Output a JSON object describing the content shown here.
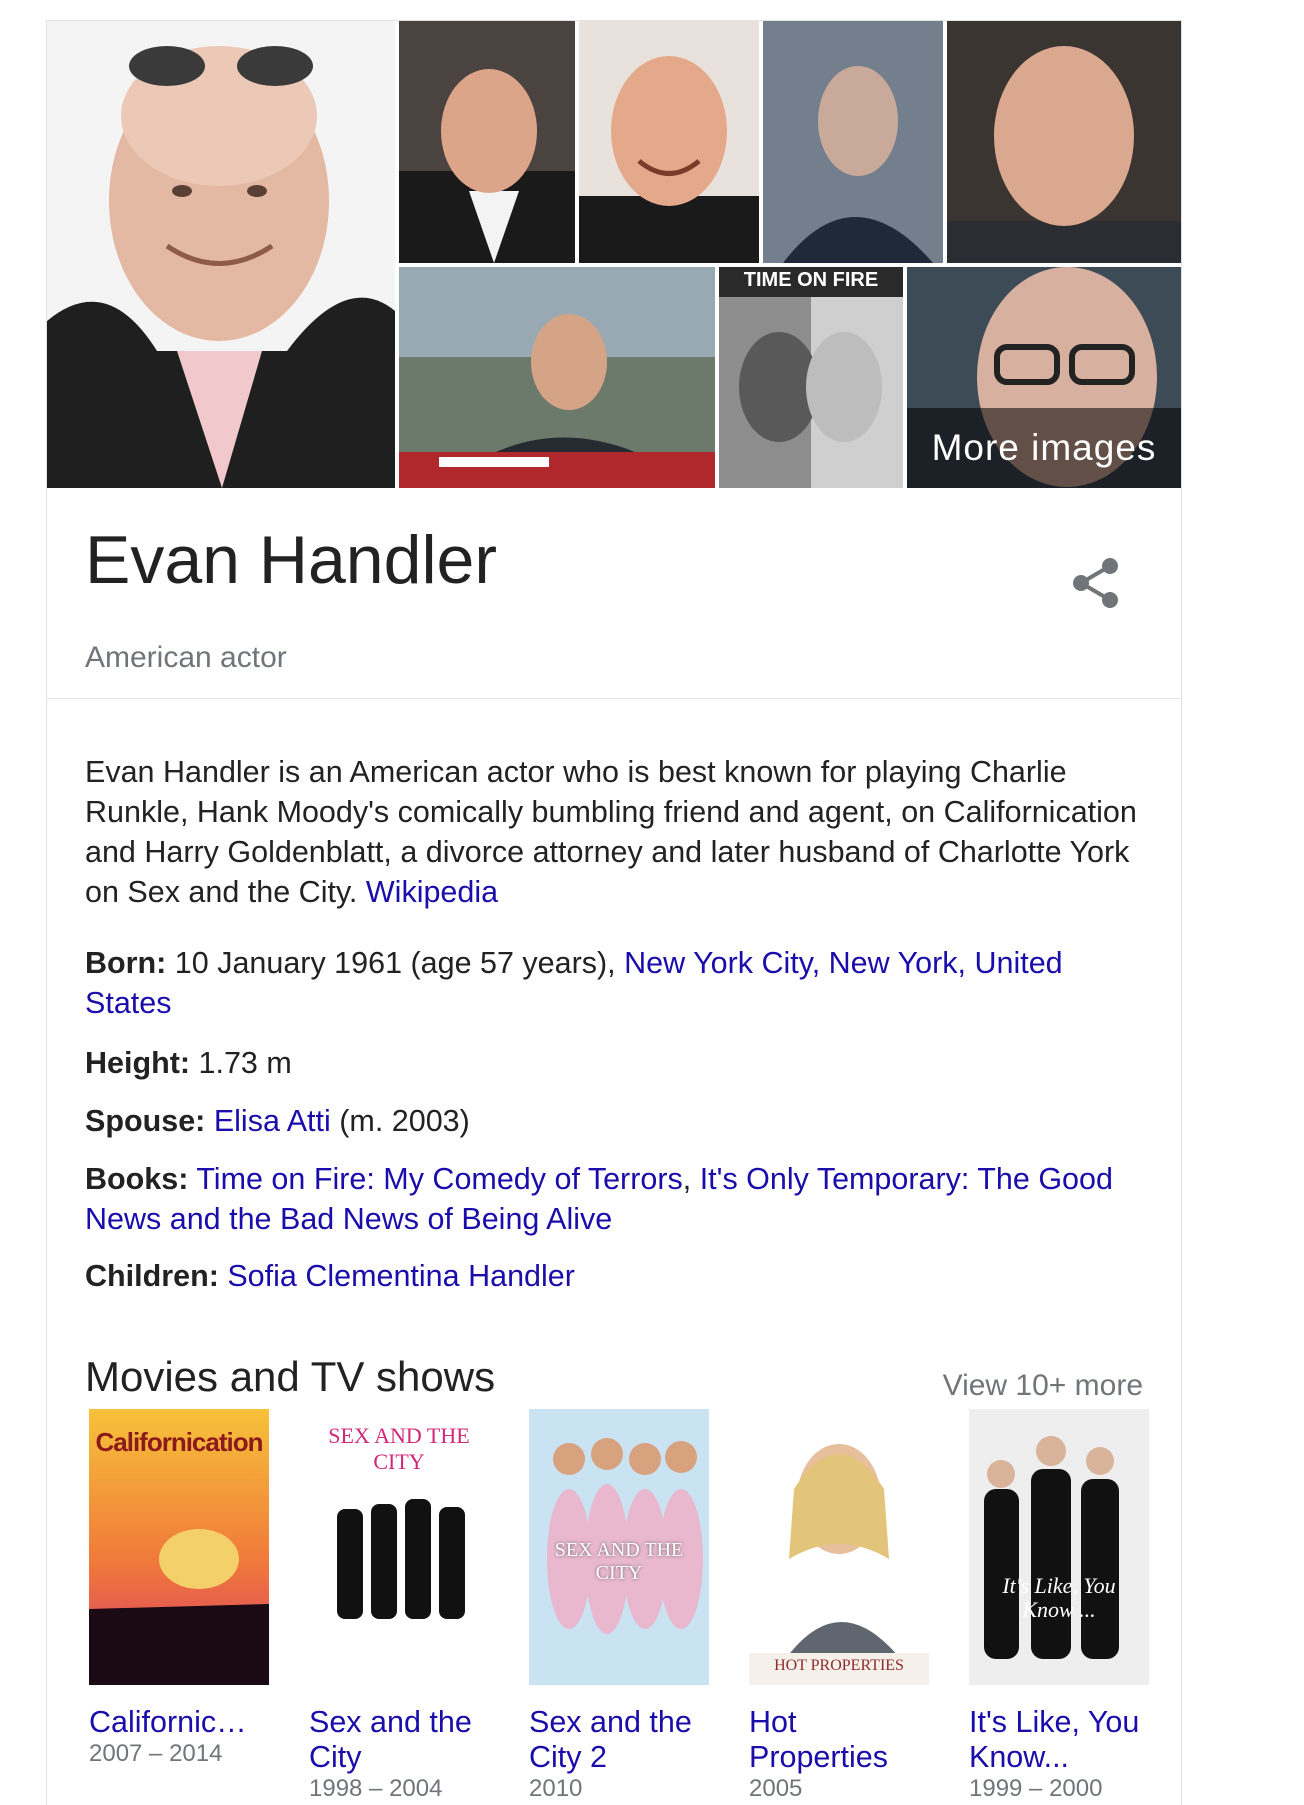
{
  "gallery": {
    "more_images_label": "More images",
    "poster_texts": {
      "time_on_fire": "TIME ON FIRE"
    }
  },
  "header": {
    "name": "Evan Handler",
    "subtitle": "American actor"
  },
  "description": {
    "text": "Evan Handler is an American actor who is best known for playing Charlie Runkle, Hank Moody's comically bumbling friend and agent, on Californication and Harry Goldenblatt, a divorce attorney and later husband of Charlotte York on Sex and the City. ",
    "source_link": "Wikipedia"
  },
  "facts": {
    "born": {
      "label": "Born:",
      "value": " 10 January 1961 (age 57 years), ",
      "link": "New York City, New York, United States"
    },
    "height": {
      "label": "Height:",
      "value": " 1.73 m"
    },
    "spouse": {
      "label": "Spouse:",
      "link": "Elisa Atti",
      "value": " (m. 2003)"
    },
    "books": {
      "label": "Books:",
      "link1": "Time on Fire: My Comedy of Terrors",
      "sep": ", ",
      "link2": "It's Only Temporary: The Good News and the Bad News of Being Alive"
    },
    "children": {
      "label": "Children:",
      "link": "Sofia Clementina Handler"
    }
  },
  "movies": {
    "section_title": "Movies and TV shows",
    "view_more": "View 10+ more",
    "items": [
      {
        "title": "Californic…",
        "years": "2007 – 2014",
        "poster_text": "Californication"
      },
      {
        "title": "Sex and the City",
        "years": "1998 – 2004",
        "poster_text": "SEX AND THE CITY"
      },
      {
        "title": "Sex and the City 2",
        "years": "2010",
        "poster_text": "SEX AND THE CITY"
      },
      {
        "title": "Hot Properties",
        "years": "2005",
        "poster_text": "HOT PROPERTIES"
      },
      {
        "title": "It's Like, You Know...",
        "years": "1999 – 2000",
        "poster_text": "It's Like, You Know ..."
      }
    ]
  },
  "colors": {
    "link": "#1a0dab",
    "text": "#222222",
    "secondary": "#70757a",
    "border": "#dfe1e5"
  }
}
